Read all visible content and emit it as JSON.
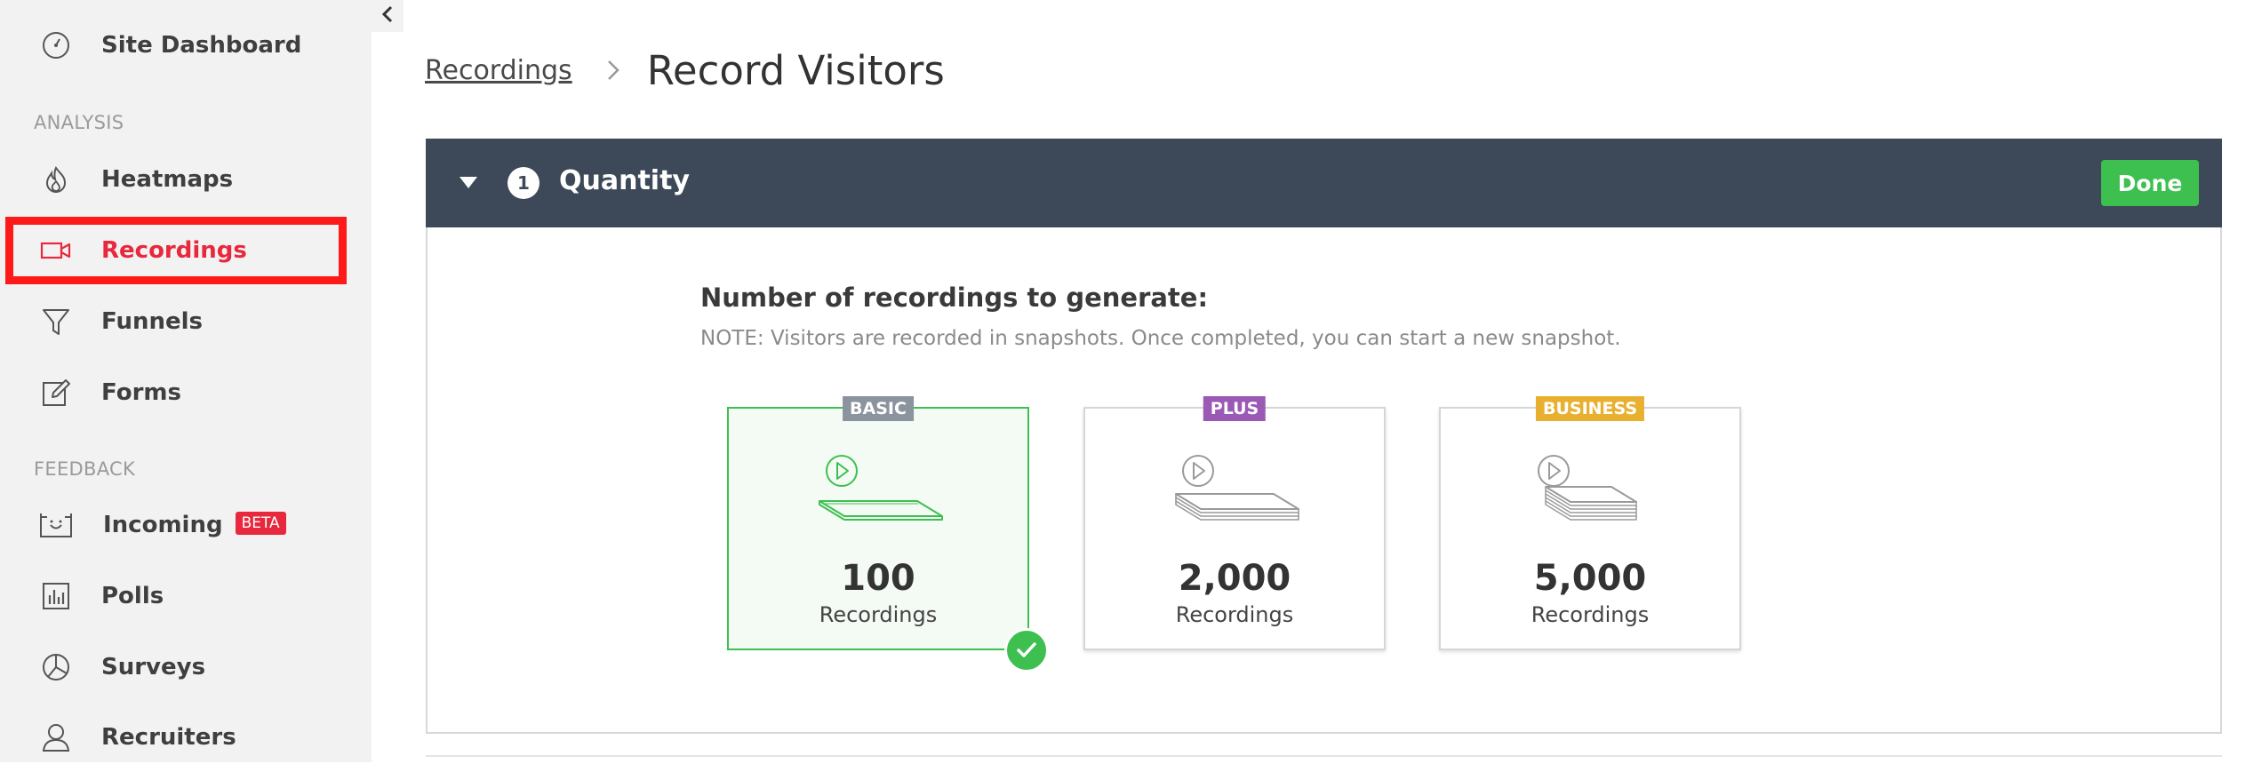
{
  "sidebar": {
    "dashboard_label": "Site Dashboard",
    "analysis_section": "ANALYSIS",
    "feedback_section": "FEEDBACK",
    "items": [
      {
        "label": "Heatmaps",
        "icon": "flame-icon"
      },
      {
        "label": "Recordings",
        "icon": "video-camera-icon"
      },
      {
        "label": "Funnels",
        "icon": "funnel-icon"
      },
      {
        "label": "Forms",
        "icon": "edit-form-icon"
      },
      {
        "label": "Incoming",
        "icon": "inbox-smile-icon",
        "badge": "BETA"
      },
      {
        "label": "Polls",
        "icon": "bar-chart-icon"
      },
      {
        "label": "Surveys",
        "icon": "pie-chart-icon"
      },
      {
        "label": "Recruiters",
        "icon": "user-icon"
      }
    ]
  },
  "breadcrumb": {
    "parent": "Recordings",
    "current": "Record Visitors"
  },
  "panel": {
    "step": "1",
    "title": "Quantity",
    "done_label": "Done"
  },
  "quantity": {
    "prompt": "Number of recordings to generate:",
    "note": "NOTE: Visitors are recorded in snapshots. Once completed, you can start a new snapshot.",
    "options": [
      {
        "tier": "BASIC",
        "count": "100",
        "unit": "Recordings",
        "selected": true
      },
      {
        "tier": "PLUS",
        "count": "2,000",
        "unit": "Recordings",
        "selected": false
      },
      {
        "tier": "BUSINESS",
        "count": "5,000",
        "unit": "Recordings",
        "selected": false
      }
    ]
  },
  "colors": {
    "active_red": "#e8283c",
    "header_bg": "#3d4858",
    "success_green": "#3dc050",
    "basic_badge": "#8a939e",
    "plus_badge": "#9b59b6",
    "business_badge": "#e9b030"
  }
}
